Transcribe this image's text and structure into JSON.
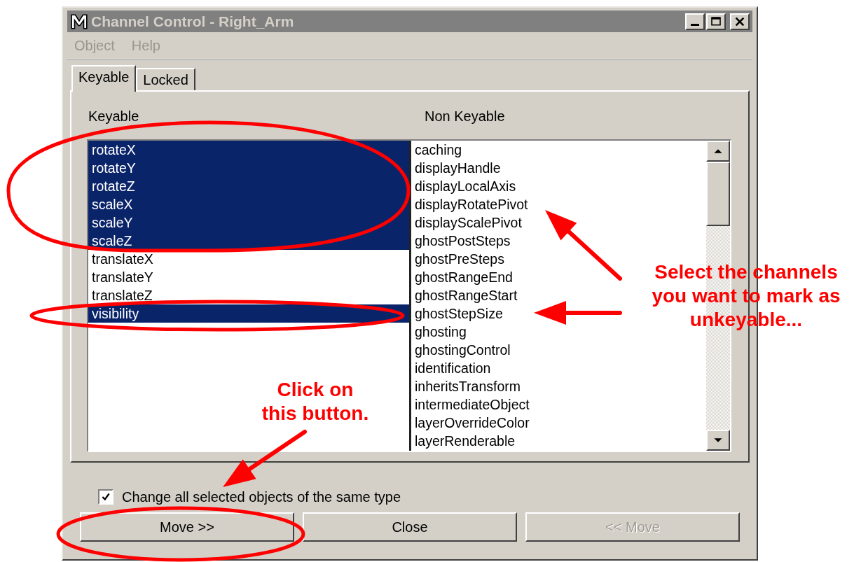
{
  "window": {
    "title": "Channel Control - Right_Arm",
    "active": false
  },
  "menu": [
    {
      "label": "Object"
    },
    {
      "label": "Help"
    }
  ],
  "tabs": [
    {
      "label": "Keyable",
      "selected": true
    },
    {
      "label": "Locked",
      "selected": false
    }
  ],
  "keyable": {
    "heading": "Keyable",
    "items": [
      {
        "label": "rotateX",
        "selected": true
      },
      {
        "label": "rotateY",
        "selected": true
      },
      {
        "label": "rotateZ",
        "selected": true
      },
      {
        "label": "scaleX",
        "selected": true
      },
      {
        "label": "scaleY",
        "selected": true
      },
      {
        "label": "scaleZ",
        "selected": true
      },
      {
        "label": "translateX",
        "selected": false
      },
      {
        "label": "translateY",
        "selected": false
      },
      {
        "label": "translateZ",
        "selected": false
      },
      {
        "label": "visibility",
        "selected": true
      }
    ]
  },
  "non_keyable": {
    "heading": "Non Keyable",
    "items": [
      {
        "label": "caching",
        "selected": false
      },
      {
        "label": "displayHandle",
        "selected": false
      },
      {
        "label": "displayLocalAxis",
        "selected": false
      },
      {
        "label": "displayRotatePivot",
        "selected": false
      },
      {
        "label": "displayScalePivot",
        "selected": false
      },
      {
        "label": "ghostPostSteps",
        "selected": false
      },
      {
        "label": "ghostPreSteps",
        "selected": false
      },
      {
        "label": "ghostRangeEnd",
        "selected": false
      },
      {
        "label": "ghostRangeStart",
        "selected": false
      },
      {
        "label": "ghostStepSize",
        "selected": false
      },
      {
        "label": "ghosting",
        "selected": false
      },
      {
        "label": "ghostingControl",
        "selected": false
      },
      {
        "label": "identification",
        "selected": false
      },
      {
        "label": "inheritsTransform",
        "selected": false
      },
      {
        "label": "intermediateObject",
        "selected": false
      },
      {
        "label": "layerOverrideColor",
        "selected": false
      },
      {
        "label": "layerRenderable",
        "selected": false
      }
    ]
  },
  "option": {
    "label": "Change all selected objects of the same type",
    "checked": true
  },
  "buttons": [
    {
      "label": "Move >>",
      "disabled": false
    },
    {
      "label": "Close",
      "disabled": false
    },
    {
      "label": "<< Move",
      "disabled": true
    }
  ],
  "annotations": [
    {
      "text": "Select the channels\nyou want to mark as\nunkeyable..."
    },
    {
      "text": "Click on\nthis button."
    }
  ]
}
